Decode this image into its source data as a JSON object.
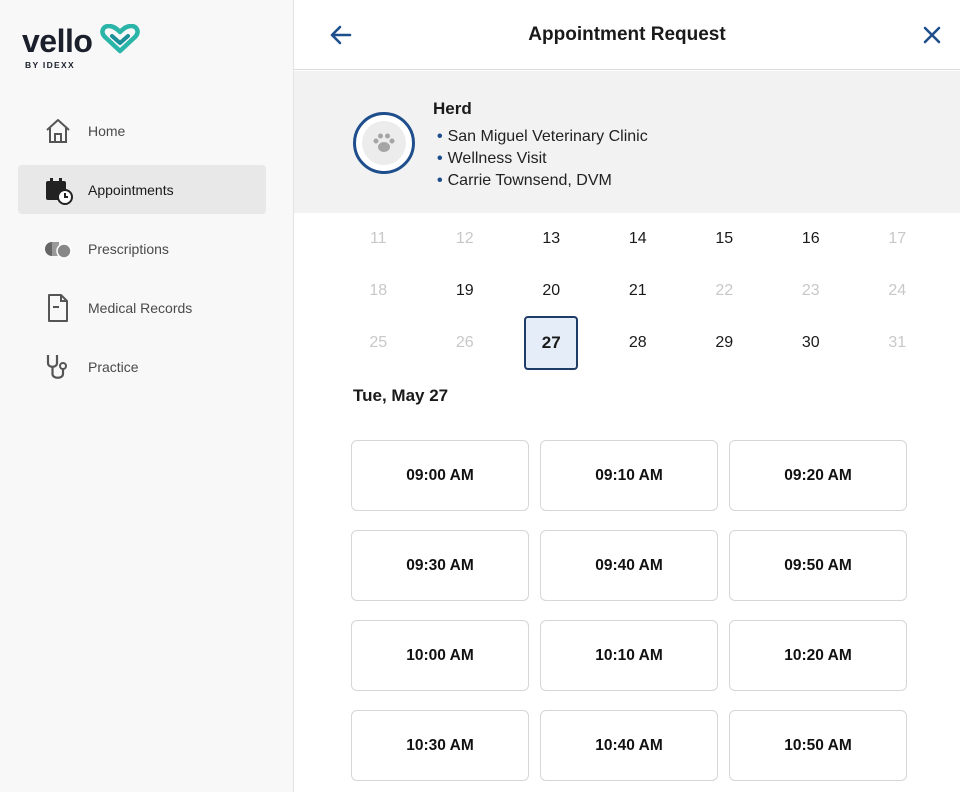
{
  "brand": {
    "name": "vello",
    "sub": "BY IDEXX",
    "accent": "#2bb5a8"
  },
  "sidebar": {
    "items": [
      {
        "label": "Home",
        "icon": "home-icon",
        "active": false
      },
      {
        "label": "Appointments",
        "icon": "calendar-clock-icon",
        "active": true
      },
      {
        "label": "Prescriptions",
        "icon": "pills-icon",
        "active": false
      },
      {
        "label": "Medical Records",
        "icon": "document-icon",
        "active": false
      },
      {
        "label": "Practice",
        "icon": "stethoscope-icon",
        "active": false
      }
    ]
  },
  "header": {
    "title": "Appointment Request",
    "back_icon": "arrow-left-icon",
    "close_icon": "close-icon"
  },
  "pet": {
    "name": "Herd",
    "avatar_icon": "paw-icon",
    "details": [
      "San Miguel Veterinary Clinic",
      "Wellness Visit",
      "Carrie Townsend, DVM"
    ]
  },
  "calendar": {
    "weeks": [
      [
        {
          "d": "11",
          "disabled": true
        },
        {
          "d": "12",
          "disabled": true
        },
        {
          "d": "13",
          "disabled": false
        },
        {
          "d": "14",
          "disabled": false
        },
        {
          "d": "15",
          "disabled": false
        },
        {
          "d": "16",
          "disabled": false
        },
        {
          "d": "17",
          "disabled": true
        }
      ],
      [
        {
          "d": "18",
          "disabled": true
        },
        {
          "d": "19",
          "disabled": false
        },
        {
          "d": "20",
          "disabled": false
        },
        {
          "d": "21",
          "disabled": false
        },
        {
          "d": "22",
          "disabled": true
        },
        {
          "d": "23",
          "disabled": true
        },
        {
          "d": "24",
          "disabled": true
        }
      ],
      [
        {
          "d": "25",
          "disabled": true
        },
        {
          "d": "26",
          "disabled": true
        },
        {
          "d": "27",
          "disabled": false,
          "selected": true
        },
        {
          "d": "28",
          "disabled": false
        },
        {
          "d": "29",
          "disabled": false
        },
        {
          "d": "30",
          "disabled": false
        },
        {
          "d": "31",
          "disabled": true
        }
      ]
    ]
  },
  "selected_date_label": "Tue, May 27",
  "time_slots": [
    "09:00 AM",
    "09:10 AM",
    "09:20 AM",
    "09:30 AM",
    "09:40 AM",
    "09:50 AM",
    "10:00 AM",
    "10:10 AM",
    "10:20 AM",
    "10:30 AM",
    "10:40 AM",
    "10:50 AM"
  ],
  "colors": {
    "primary": "#1f4e8c",
    "selected_bg": "#e4edf8",
    "disabled_text": "#c8c8c8"
  }
}
